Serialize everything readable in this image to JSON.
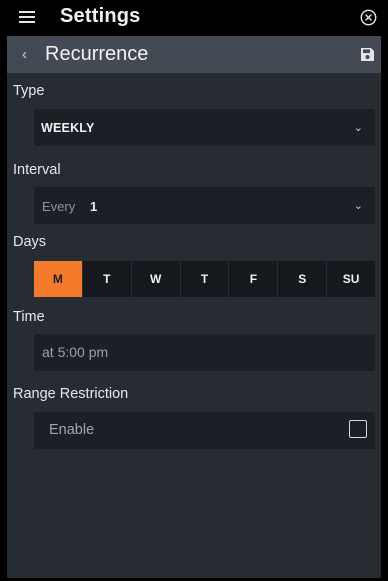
{
  "topbar": {
    "title": "Settings",
    "menu_icon": "hamburger-icon",
    "close_icon": "close-circle-icon"
  },
  "subbar": {
    "back_icon": "chevron-left-icon",
    "title": "Recurrence",
    "save_icon": "save-icon"
  },
  "type_section": {
    "label": "Type",
    "selected": "WEEKLY"
  },
  "interval_section": {
    "label": "Interval",
    "prefix": "Every",
    "value": "1"
  },
  "days_section": {
    "label": "Days",
    "days": [
      "M",
      "T",
      "W",
      "T",
      "F",
      "S",
      "SU"
    ],
    "active_day": "M"
  },
  "time_section": {
    "label": "Time",
    "value": "at 5:00 pm"
  },
  "range_section": {
    "label": "Range Restriction",
    "enable_label": "Enable",
    "enabled": false
  },
  "colors": {
    "accent": "#f47a2c",
    "background": "#272c33",
    "field": "#1c2026",
    "subbar": "#434a53"
  }
}
